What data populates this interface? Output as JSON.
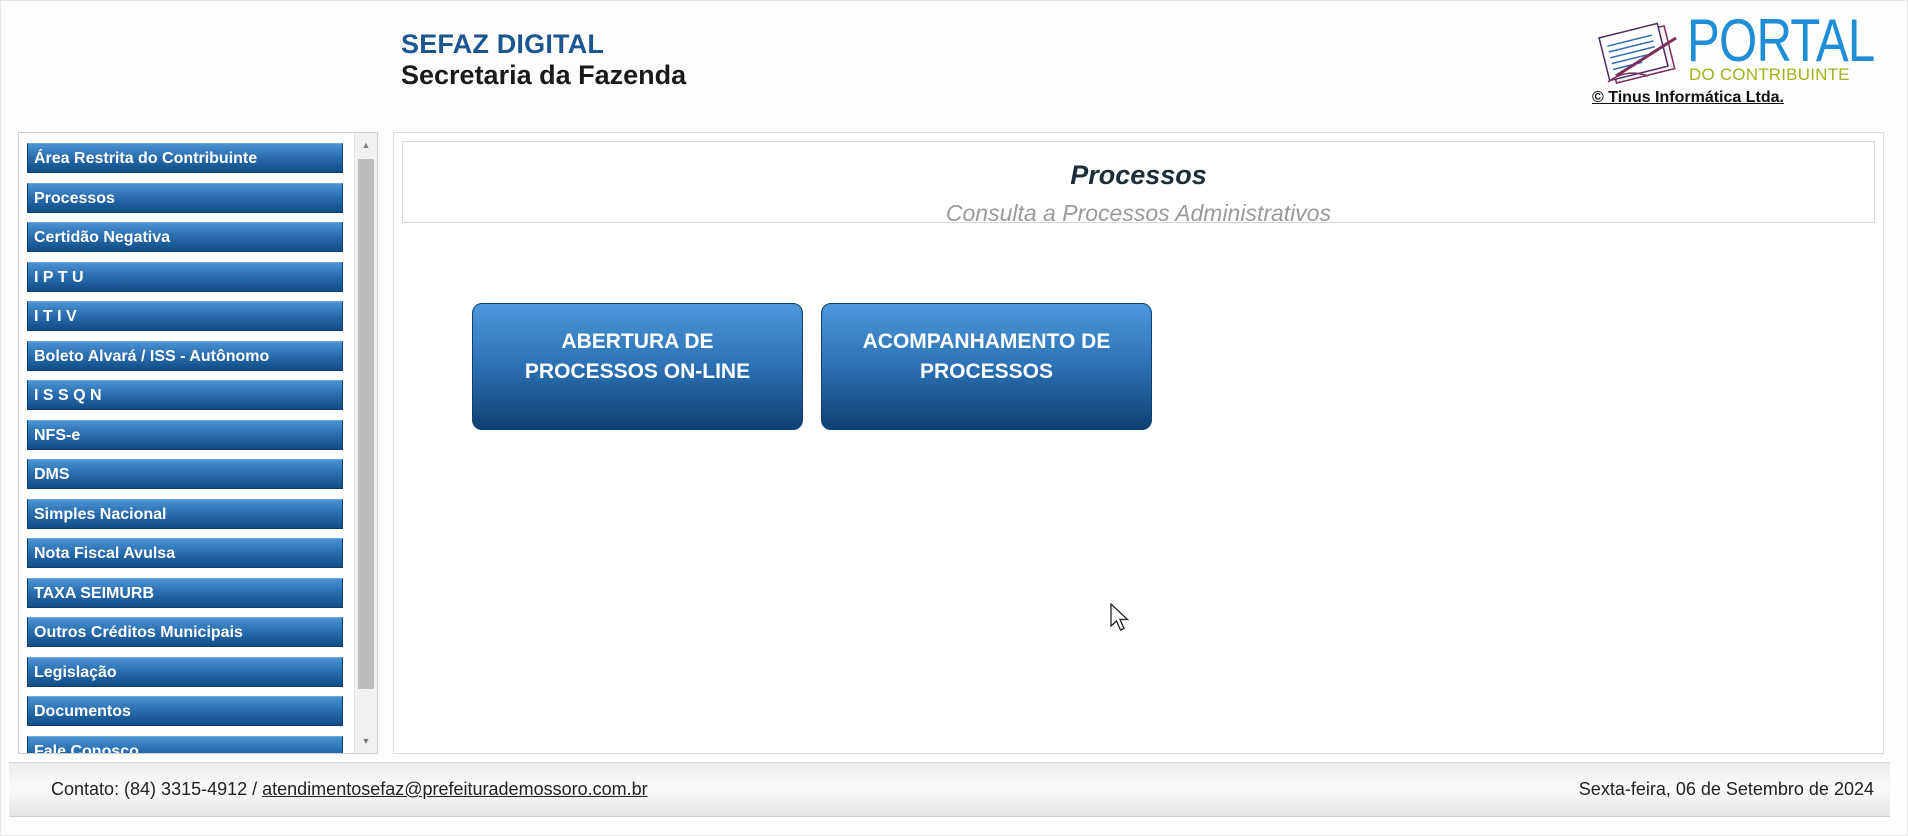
{
  "header": {
    "title": "SEFAZ DIGITAL",
    "subtitle": "Secretaria da Fazenda",
    "logo_main": "PORTAL",
    "logo_sub": "DO CONTRIBUINTE",
    "copyright": "© Tinus Informática Ltda."
  },
  "sidebar": {
    "items": [
      {
        "label": "Área Restrita do Contribuinte"
      },
      {
        "label": "Processos"
      },
      {
        "label": "Certidão Negativa"
      },
      {
        "label": "I P T U"
      },
      {
        "label": "I T I V"
      },
      {
        "label": "Boleto Alvará / ISS - Autônomo"
      },
      {
        "label": "I S S Q N"
      },
      {
        "label": "NFS-e"
      },
      {
        "label": "DMS"
      },
      {
        "label": "Simples Nacional"
      },
      {
        "label": "Nota Fiscal Avulsa"
      },
      {
        "label": "TAXA SEIMURB"
      },
      {
        "label": "Outros Créditos Municipais"
      },
      {
        "label": "Legislação"
      },
      {
        "label": "Documentos"
      },
      {
        "label": "Fale Conosco"
      }
    ]
  },
  "content": {
    "title": "Processos",
    "subtitle": "Consulta a Processos Administrativos",
    "buttons": [
      {
        "label": "ABERTURA DE\nPROCESSOS ON-LINE"
      },
      {
        "label": "ACOMPANHAMENTO DE\nPROCESSOS"
      }
    ]
  },
  "footer": {
    "contact_prefix": "Contato: (84) 3315-4912 / ",
    "email": "atendimentosefaz@prefeiturademossoro.com.br",
    "date": "Sexta-feira, 06 de Setembro de 2024"
  },
  "colors": {
    "brand_blue": "#1b5690",
    "button_gradient_top": "#4c98da",
    "button_gradient_bottom": "#103f73",
    "logo_green": "#a2b21b"
  }
}
